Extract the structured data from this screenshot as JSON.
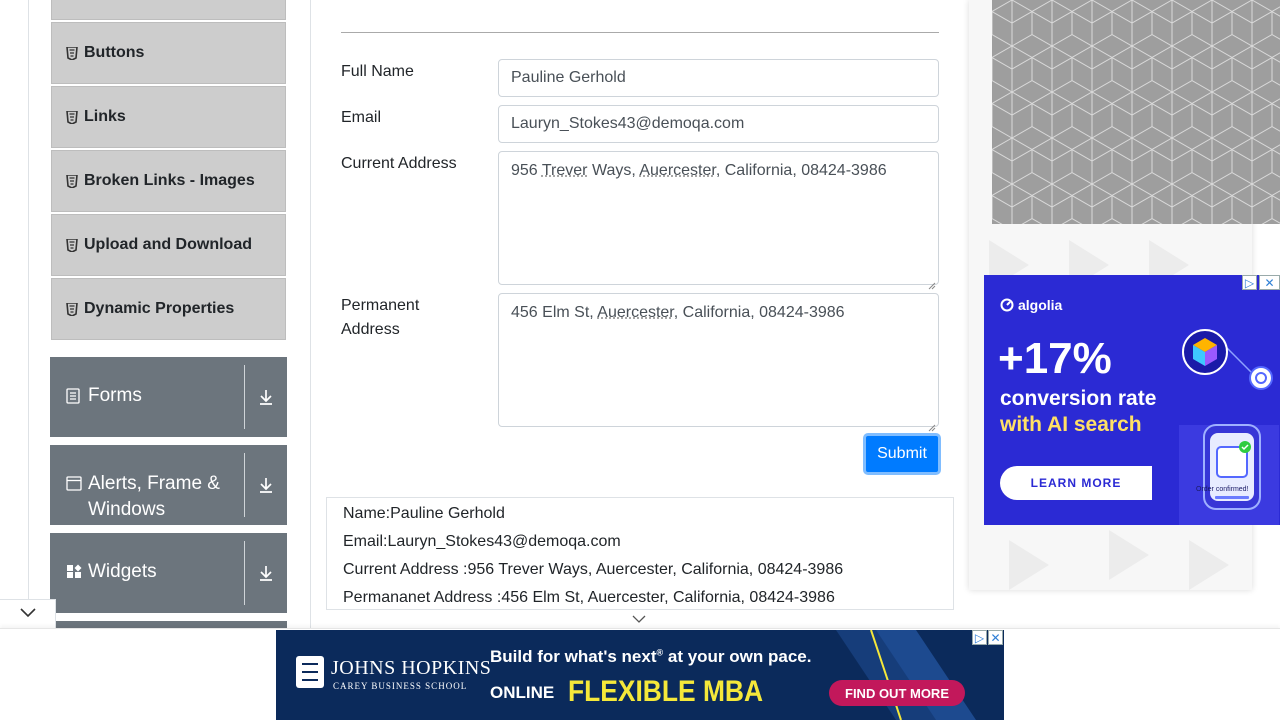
{
  "sidebar": {
    "items": [
      {
        "label": "Buttons",
        "icon": "html5-icon"
      },
      {
        "label": "Links",
        "icon": "html5-icon"
      },
      {
        "label": "Broken Links - Images",
        "icon": "html5-icon"
      },
      {
        "label": "Upload and Download",
        "icon": "html5-icon"
      },
      {
        "label": "Dynamic Properties",
        "icon": "html5-icon"
      }
    ],
    "groups": [
      {
        "label": "Forms",
        "icon": "document-icon"
      },
      {
        "label": "Alerts, Frame &",
        "label2": "Windows",
        "icon": "window-icon"
      },
      {
        "label": "Widgets",
        "icon": "widgets-icon"
      }
    ]
  },
  "form": {
    "full_name_label": "Full Name",
    "full_name_value": "Pauline Gerhold",
    "email_label": "Email",
    "email_value": "Lauryn_Stokes43@demoqa.com",
    "current_address_label": "Current Address",
    "current_address_parts": [
      "956 ",
      "Trever",
      " Ways, ",
      "Auercester",
      ", California, 08424-3986"
    ],
    "permanent_address_label_1": "Permanent",
    "permanent_address_label_2": "Address",
    "permanent_address_parts": [
      "456 Elm St, ",
      "Auercester",
      ", California, 08424-3986"
    ],
    "submit_label": "Submit"
  },
  "output": {
    "name": "Name:Pauline Gerhold",
    "email": "Email:Lauryn_Stokes43@demoqa.com",
    "current_address": "Current Address :956 Trever Ways, Auercester, California, 08424-3986",
    "permanent_address": "Permananet Address :456 Elm St, Auercester, California, 08424-3986"
  },
  "ads": {
    "algolia": {
      "brand": "algolia",
      "headline_big": "+17%",
      "headline_line2": "conversion rate",
      "headline_line3": "with AI search",
      "cta": "LEARN MORE",
      "caption": "Order confirmed!",
      "accent": "#ffe066"
    },
    "jhu": {
      "brand_line1": "JOHNS HOPKINS",
      "brand_line2": "CAREY BUSINESS SCHOOL",
      "tagline": "Build for what's next",
      "tagline_mark": "®",
      "tagline_rest": " at your own pace.",
      "online": "ONLINE",
      "program": "FLEXIBLE MBA",
      "cta": "FIND OUT MORE",
      "accent_yellow": "#f5e83a",
      "accent_pink": "#c2185b"
    }
  },
  "colors": {
    "primary_button": "#007bff",
    "group_header": "#6c757d",
    "menu_item": "#cdcdcd"
  }
}
